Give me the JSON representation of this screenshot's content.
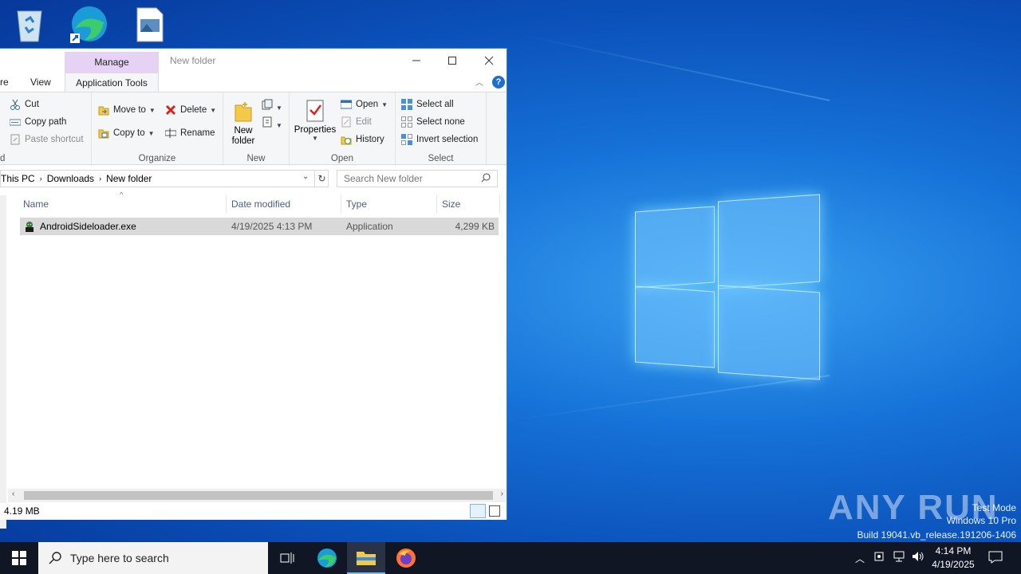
{
  "window": {
    "title": "New folder",
    "context_tab": "Manage",
    "tabs": [
      "re",
      "View",
      "Application Tools"
    ],
    "controls": [
      "minimize",
      "maximize",
      "close"
    ]
  },
  "ribbon": {
    "clipboard": {
      "cut": "Cut",
      "copy_path": "Copy path",
      "paste_shortcut": "Paste shortcut",
      "label": "d"
    },
    "organize": {
      "move_to": "Move to",
      "copy_to": "Copy to",
      "delete": "Delete",
      "rename": "Rename",
      "label": "Organize"
    },
    "new": {
      "new_folder_line1": "New",
      "new_folder_line2": "folder",
      "label": "New"
    },
    "open": {
      "properties": "Properties",
      "open": "Open",
      "edit": "Edit",
      "history": "History",
      "label": "Open"
    },
    "select": {
      "select_all": "Select all",
      "select_none": "Select none",
      "invert_selection": "Invert selection",
      "label": "Select"
    }
  },
  "address": {
    "breadcrumb": [
      "This PC",
      "Downloads",
      "New folder"
    ],
    "search_placeholder": "Search New folder"
  },
  "columns": [
    "Name",
    "Date modified",
    "Type",
    "Size"
  ],
  "files": [
    {
      "name": "AndroidSideloader.exe",
      "date_modified": "4/19/2025 4:13 PM",
      "type": "Application",
      "size": "4,299 KB"
    }
  ],
  "status": {
    "selection_size": "4.19 MB"
  },
  "watermark": {
    "brand": "ANY RUN",
    "mode": "Test Mode",
    "edition": "Windows 10 Pro",
    "build": "Build 19041.vb_release.191206-1406"
  },
  "taskbar": {
    "search_placeholder": "Type here to search",
    "time": "4:14 PM",
    "date": "4/19/2025",
    "pinned": [
      "task-view-icon",
      "edge-icon",
      "file-explorer-icon",
      "firefox-icon"
    ]
  },
  "desktop_icons": [
    "recycle-bin-icon",
    "edge-shortcut-icon",
    "image-file-icon"
  ],
  "colors": {
    "accent": "#1672d8",
    "manage_tab": "#e6d2f5",
    "selected_row": "#d9d9d9",
    "taskbar": "#101623"
  }
}
